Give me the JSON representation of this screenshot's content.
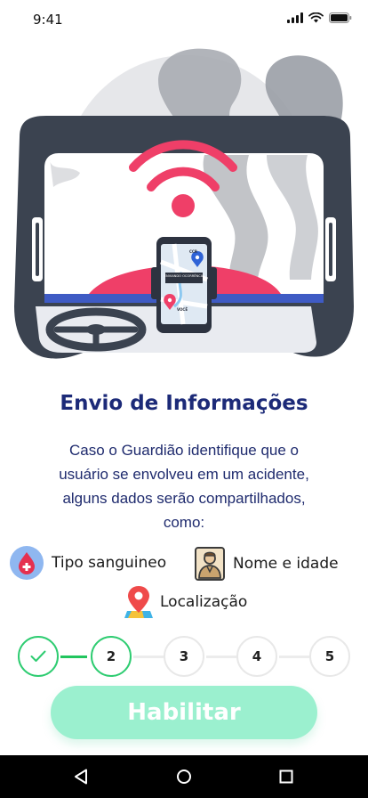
{
  "status_bar": {
    "time": "9:41"
  },
  "screen": {
    "title": "Envio de Informações",
    "description": "Caso o Guardião identifique que o usuário se envolveu em um acidente, alguns dados serão compartilhados, como:"
  },
  "illustration": {
    "phone_label_top": "CCR",
    "phone_banner": "ENVIANDO OCORRÊNCIA",
    "phone_label_bottom": "VOCÊ"
  },
  "features": [
    {
      "label": "Tipo sanguineo",
      "icon": "blood-drop-icon"
    },
    {
      "label": "Nome e idade",
      "icon": "person-icon"
    },
    {
      "label": "Localização",
      "icon": "location-pin-icon"
    }
  ],
  "stepper": {
    "current": 2,
    "steps": [
      {
        "label": "",
        "state": "done"
      },
      {
        "label": "2",
        "state": "active"
      },
      {
        "label": "3",
        "state": "pending"
      },
      {
        "label": "4",
        "state": "pending"
      },
      {
        "label": "5",
        "state": "pending"
      }
    ]
  },
  "primary_button": {
    "label": "Habilitar"
  },
  "colors": {
    "title": "#1c2a78",
    "accent_green": "#2ecc71",
    "button_bg": "#9bf0cf",
    "alert_red": "#f0446a",
    "car_dark": "#3b4350"
  }
}
